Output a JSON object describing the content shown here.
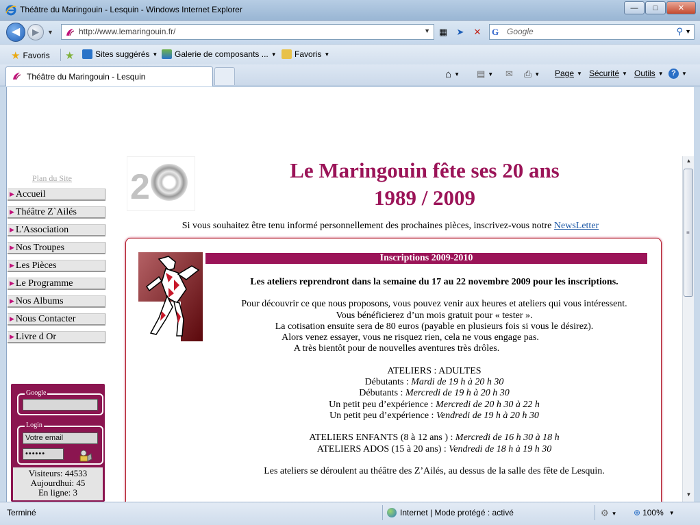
{
  "window": {
    "title": "Théâtre du Maringouin - Lesquin - Windows Internet Explorer",
    "buttons": {
      "minimize": "—",
      "maximize": "□",
      "close": "✕"
    }
  },
  "address_bar": {
    "url": "http://www.lemaringouin.fr/",
    "search_placeholder": "Google",
    "search_provider": "G"
  },
  "favorites_bar": {
    "favorites_label": "Favoris",
    "suggested_label": "Sites suggérés",
    "gallery_label": "Galerie de composants ...",
    "favorites_folder_label": "Favoris"
  },
  "tab": {
    "title": "Théâtre du Maringouin - Lesquin"
  },
  "command_bar": {
    "page_label": "Page",
    "security_label": "Sécurité",
    "tools_label": "Outils"
  },
  "site": {
    "plan_link": "Plan du Site",
    "menu": [
      {
        "label": "Accueil"
      },
      {
        "label": "Théâtre Z`Ailés"
      },
      {
        "label": "L'Association"
      },
      {
        "label": "Nos Troupes"
      },
      {
        "label": "Les Pièces"
      },
      {
        "label": "Le Programme"
      },
      {
        "label": "Nos Albums"
      },
      {
        "label": "Nous Contacter"
      },
      {
        "label": "Livre d Or"
      }
    ],
    "logo_digit": "2",
    "headline_line1": "Le Maringouin fête ses 20 ans",
    "headline_line2": "1989 / 2009",
    "newsletter_text": "Si vous souhaitez être tenu informé personnellement des prochaines pièces, inscrivez-vous notre",
    "newsletter_link": "NewsLetter",
    "box": {
      "bar_title": "Inscriptions 2009-2010",
      "intro_bold": "Les ateliers reprendront dans la semaine du 17 au 22 novembre 2009 pour les inscriptions.",
      "para_lines": [
        "Pour découvrir ce que nous proposons, vous pouvez venir aux heures et ateliers qui vous intéressent.",
        "Vous bénéficierez d’un mois gratuit pour « tester ».",
        "La cotisation ensuite sera de 80 euros (payable en plusieurs fois si vous le désirez).",
        "Alors venez essayer, vous ne risquez rien, cela ne vous engage pas.",
        "A très bientôt pour de nouvelles aventures très drôles."
      ],
      "adults_title": "ATELIERS : ADULTES",
      "adults": [
        {
          "label": "Débutants : ",
          "time": "Mardi de 19 h à 20 h 30"
        },
        {
          "label": "Débutants : ",
          "time": "Mercredi de 19 h à 20 h 30"
        },
        {
          "label": "Un petit peu d’expérience : ",
          "time": "Mercredi de 20 h 30 à 22 h"
        },
        {
          "label": "Un petit peu d’expérience : ",
          "time": "Vendredi de 19 h à 20 h 30"
        }
      ],
      "kids": [
        {
          "label": "ATELIERS ENFANTS (8 à 12 ans ) : ",
          "time": "Mercredi de 16 h 30 à 18 h"
        },
        {
          "label": "ATELIERS ADOS (15 à 20 ans) : ",
          "time": "Vendredi de 18 h à 19 h 30"
        }
      ],
      "location": "Les ateliers se déroulent au théâtre des Z’Ailés, au dessus de la salle des fête de Lesquin."
    },
    "side_panel": {
      "google_legend": "Google",
      "google_value": "",
      "login_legend": "Login",
      "email_value": "Votre email",
      "password_value": "••••••",
      "visitors": "Visiteurs: 44533",
      "today": "Aujourdhui: 45",
      "online": "En ligne: 3"
    }
  },
  "status_bar": {
    "status": "Terminé",
    "zone": "Internet | Mode protégé : activé",
    "zoom": "100%"
  },
  "colors": {
    "brand": "#9b1458",
    "panel": "#8b1550",
    "link": "#1c57a5"
  }
}
